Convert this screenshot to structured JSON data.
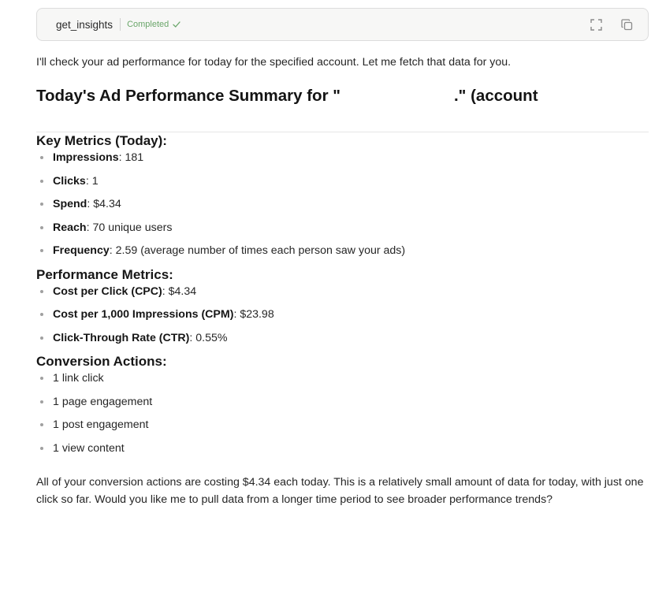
{
  "tool_call": {
    "name": "get_insights",
    "status": "Completed",
    "expand_icon": "expand-icon",
    "copy_icon": "copy-icon",
    "status_color": "#6aa66a"
  },
  "intro": "I'll check your ad performance for today for the specified account. Let me fetch that data for you.",
  "summary_title": {
    "prefix": "Today's Ad Performance Summary for \"",
    "suffix": ".\" (account"
  },
  "key_metrics": {
    "heading": "Key Metrics (Today):",
    "items": [
      {
        "label": "Impressions",
        "value": ": 181"
      },
      {
        "label": "Clicks",
        "value": ": 1"
      },
      {
        "label": "Spend",
        "value": ": $4.34"
      },
      {
        "label": "Reach",
        "value": ": 70 unique users"
      },
      {
        "label": "Frequency",
        "value": ": 2.59 (average number of times each person saw your ads)"
      }
    ]
  },
  "performance_metrics": {
    "heading": "Performance Metrics:",
    "items": [
      {
        "label": "Cost per Click (CPC)",
        "value": ": $4.34"
      },
      {
        "label": "Cost per 1,000 Impressions (CPM)",
        "value": ": $23.98"
      },
      {
        "label": "Click-Through Rate (CTR)",
        "value": ": 0.55%"
      }
    ]
  },
  "conversion_actions": {
    "heading": "Conversion Actions:",
    "items": [
      "1 link click",
      "1 page engagement",
      "1 post engagement",
      "1 view content"
    ]
  },
  "closing": "All of your conversion actions are costing $4.34 each today. This is a relatively small amount of data for today, with just one click so far. Would you like me to pull data from a longer time period to see broader performance trends?"
}
